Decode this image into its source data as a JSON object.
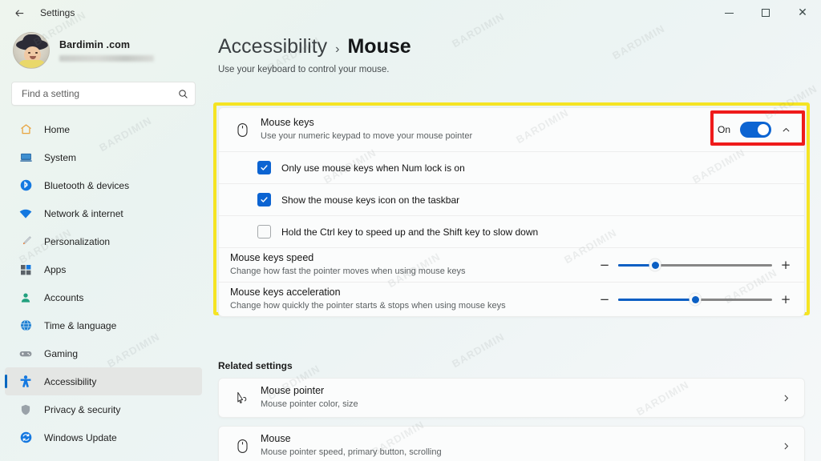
{
  "window": {
    "title": "Settings",
    "back_icon": "back-arrow-icon",
    "controls": {
      "minimize": "minimize-icon",
      "maximize": "maximize-icon",
      "close": "close-icon"
    }
  },
  "sidebar": {
    "account": {
      "name": "Bardimin .com",
      "email_redacted": ""
    },
    "search": {
      "placeholder": "Find a setting",
      "value": "",
      "icon": "search-icon"
    },
    "items": [
      {
        "label": "Home",
        "icon": "home-icon",
        "active": false
      },
      {
        "label": "System",
        "icon": "system-icon",
        "active": false
      },
      {
        "label": "Bluetooth & devices",
        "icon": "bluetooth-icon",
        "active": false
      },
      {
        "label": "Network & internet",
        "icon": "network-icon",
        "active": false
      },
      {
        "label": "Personalization",
        "icon": "personalization-icon",
        "active": false
      },
      {
        "label": "Apps",
        "icon": "apps-icon",
        "active": false
      },
      {
        "label": "Accounts",
        "icon": "accounts-icon",
        "active": false
      },
      {
        "label": "Time & language",
        "icon": "time-language-icon",
        "active": false
      },
      {
        "label": "Gaming",
        "icon": "gaming-icon",
        "active": false
      },
      {
        "label": "Accessibility",
        "icon": "accessibility-icon",
        "active": true
      },
      {
        "label": "Privacy & security",
        "icon": "privacy-security-icon",
        "active": false
      },
      {
        "label": "Windows Update",
        "icon": "windows-update-icon",
        "active": false
      }
    ]
  },
  "main": {
    "breadcrumb": {
      "parent": "Accessibility",
      "separator": "›",
      "current": "Mouse"
    },
    "subtitle": "Use your keyboard to control your mouse.",
    "mouse_keys": {
      "icon": "mouse-icon",
      "title": "Mouse keys",
      "description": "Use your numeric keypad to move your mouse pointer",
      "toggle_label": "On",
      "toggle_state": "on",
      "expand_icon": "chevron-up-icon",
      "checkboxes": [
        {
          "label": "Only use mouse keys when Num lock is on",
          "checked": true
        },
        {
          "label": "Show the mouse keys icon on the taskbar",
          "checked": true
        },
        {
          "label": "Hold the Ctrl key to speed up and the Shift key to slow down",
          "checked": false
        }
      ],
      "sliders": [
        {
          "title": "Mouse keys speed",
          "description": "Change how fast the pointer moves when using mouse keys",
          "minus": "−",
          "plus": "+",
          "value_percent": 24
        },
        {
          "title": "Mouse keys acceleration",
          "description": "Change how quickly the pointer starts & stops when using mouse keys",
          "minus": "−",
          "plus": "+",
          "value_percent": 50
        }
      ]
    },
    "related_settings": {
      "heading": "Related settings",
      "items": [
        {
          "icon": "mouse-pointer-icon",
          "title": "Mouse pointer",
          "description": "Mouse pointer color, size",
          "chevron": "chevron-right-icon"
        },
        {
          "icon": "mouse-icon",
          "title": "Mouse",
          "description": "Mouse pointer speed, primary button, scrolling",
          "chevron": "chevron-right-icon"
        }
      ]
    }
  },
  "annotations": {
    "highlight_yellow_color": "#f5e423",
    "highlight_red_color": "#ef1b1b"
  },
  "watermark": {
    "text": "BARDIMIN"
  }
}
